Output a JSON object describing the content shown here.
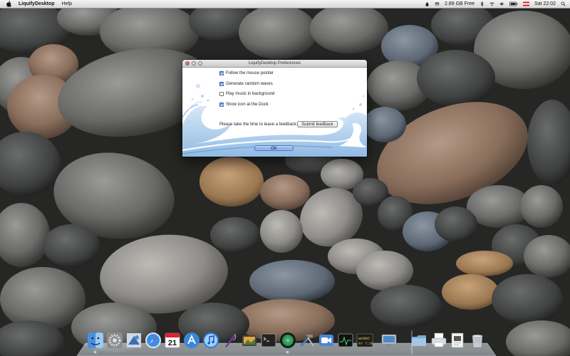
{
  "menubar": {
    "app_name": "LiquifyDesktop",
    "items": [
      "Help"
    ],
    "status": {
      "disk_free": "2.89 GB Free",
      "input_source": "",
      "clock": "Sat 22:02"
    },
    "icons": [
      "apple-icon",
      "drop-icon",
      "disk-icon",
      "bluetooth-icon",
      "wifi-icon",
      "volume-icon",
      "battery-icon",
      "flag-icon",
      "spotlight-icon"
    ]
  },
  "prefs_window": {
    "title": "LiquifyDesktop Preferences",
    "options": [
      {
        "label": "Follow the mouse pointer",
        "checked": true
      },
      {
        "label": "Generate random waves",
        "checked": true
      },
      {
        "label": "Play music in background",
        "checked": false
      },
      {
        "label": "Show icon at the Dock",
        "checked": true
      }
    ],
    "feedback_prompt": "Please take the time to leave a feedback",
    "feedback_button": "Submit feedback",
    "ok_button": "OK"
  },
  "dock": {
    "calendar_day": "21",
    "console_text": "WARNI\nAY 7:36",
    "apps": [
      "finder-icon",
      "system-preferences-icon",
      "preview-icon",
      "safari-icon",
      "ical-icon",
      "app-store-icon",
      "itunes-icon",
      "quill-icon",
      "iphoto-icon",
      "terminal-icon",
      "liquify-icon",
      "xcode-icon",
      "facetime-icon",
      "activity-monitor-icon",
      "console-icon",
      "display-icon",
      "folder-icon",
      "printer-icon",
      "document-icon",
      "trash-icon"
    ]
  },
  "colors": {
    "menubar": "#e6e6e6",
    "ok_button": "#7eaef0",
    "close_light": "#d2281c"
  }
}
